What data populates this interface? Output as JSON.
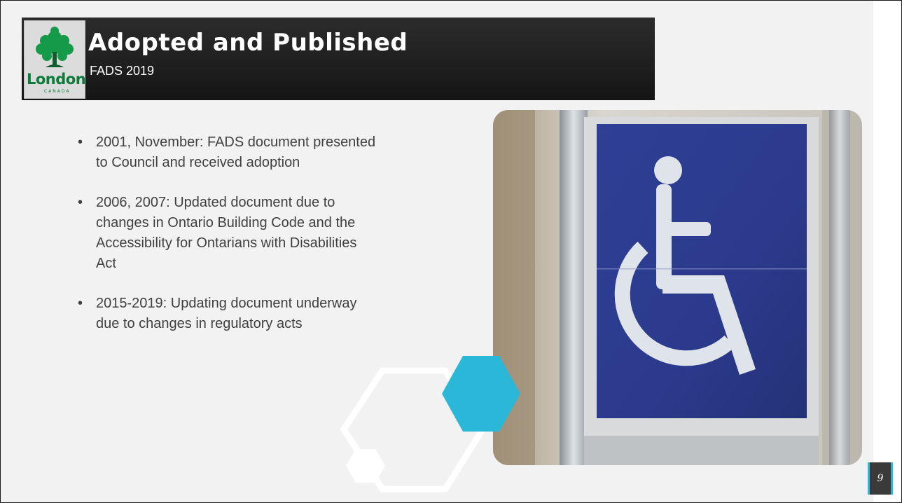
{
  "header": {
    "title": "Adopted and Published",
    "subtitle": "FADS 2019",
    "logo": {
      "word": "London",
      "sub": "CANADA",
      "icon": "tree-icon"
    }
  },
  "bullets": [
    "2001, November: FADS document presented to Council and received adoption",
    "2006, 2007:  Updated document due to changes in Ontario Building Code and the Accessibility for Ontarians with Disabilities Act",
    "2015-2019:  Updating document underway due to changes in regulatory acts"
  ],
  "bullet_glyph": "•",
  "image": {
    "icon": "wheelchair-accessibility-icon"
  },
  "page_number": "9",
  "colors": {
    "accent": "#2bb7d8",
    "title_bar": "#1e1e1e",
    "sign_blue": "#2b3a8c",
    "logo_green": "#0d7a3a"
  }
}
